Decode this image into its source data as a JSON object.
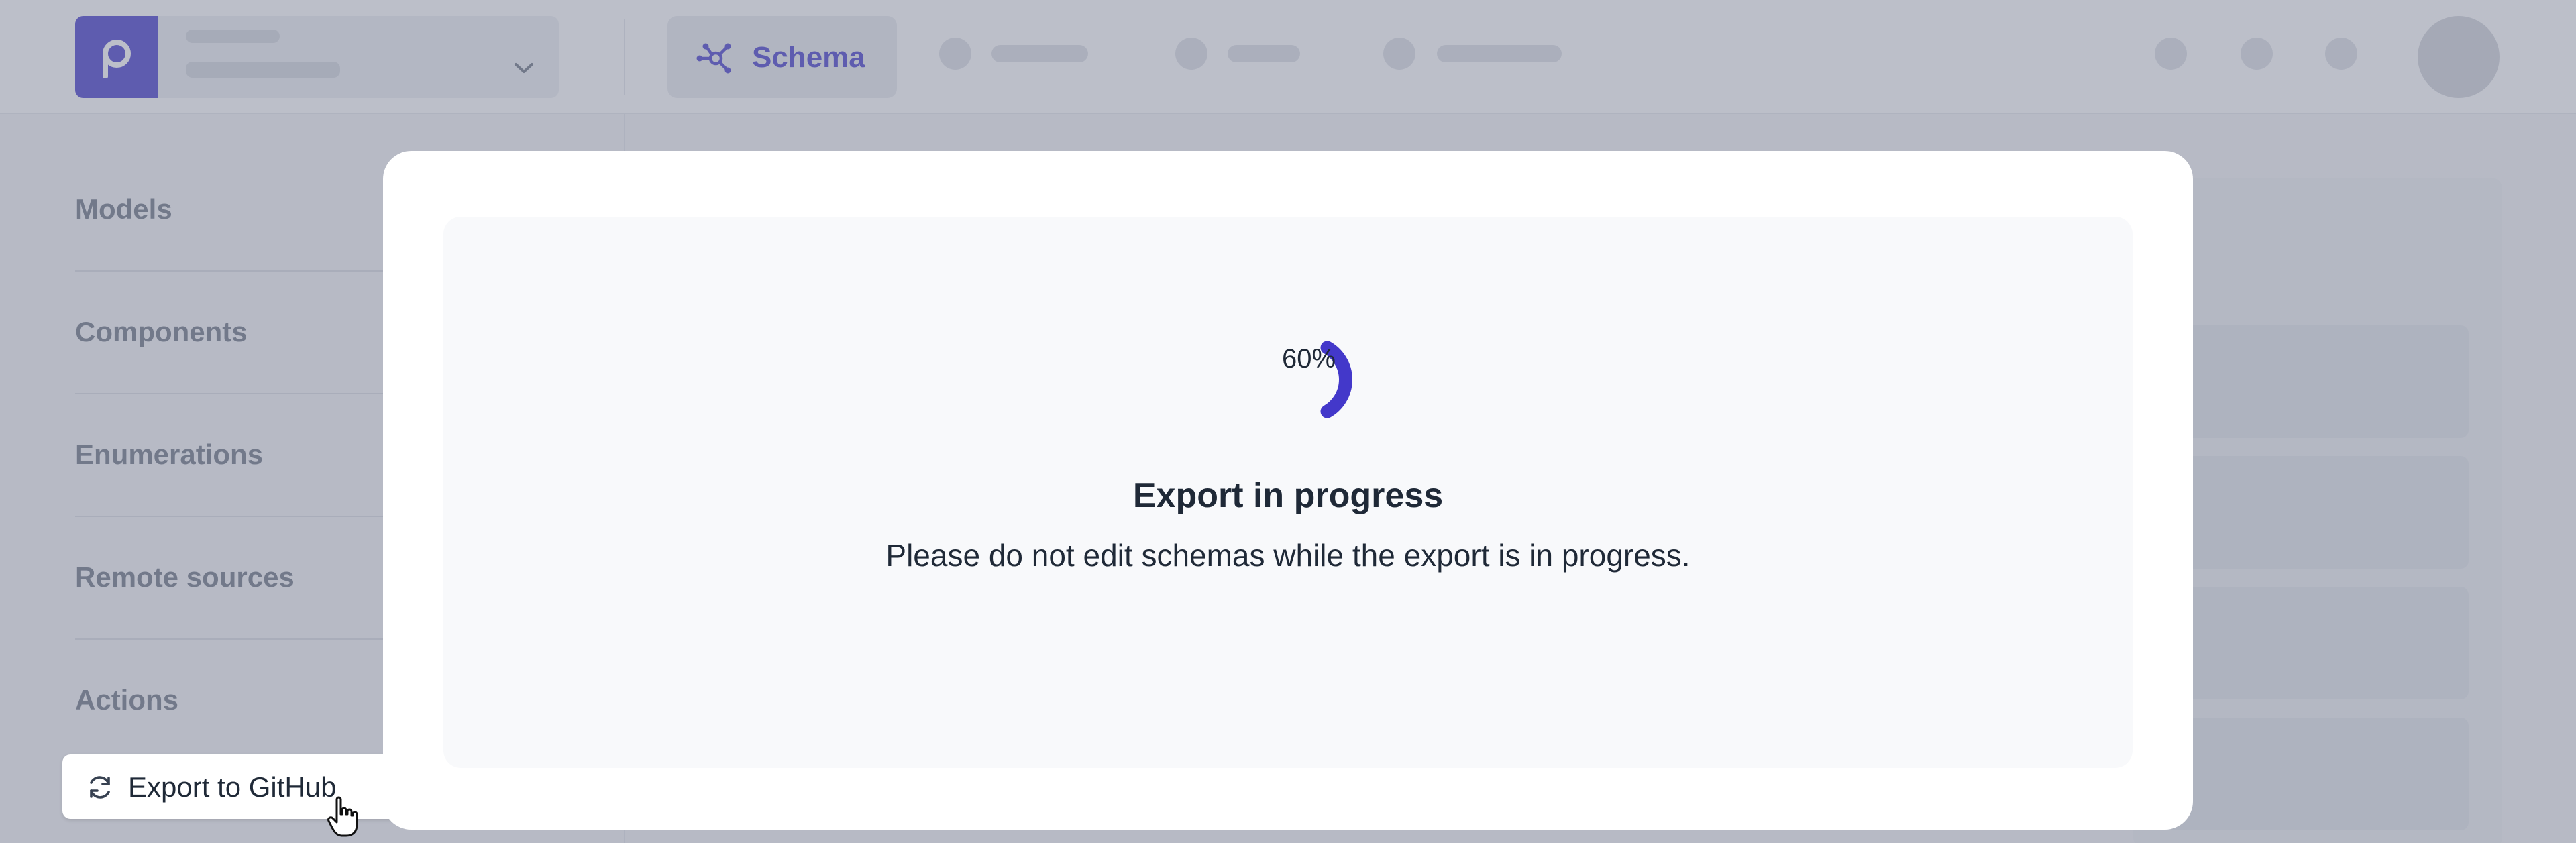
{
  "header": {
    "active_tab_label": "Schema",
    "icons": [
      "project-logo-icon",
      "chevron-down-icon",
      "schema-graph-icon"
    ]
  },
  "sidebar": {
    "sections": [
      "Models",
      "Components",
      "Enumerations",
      "Remote sources",
      "Actions"
    ],
    "export_button_label": "Export to GitHub",
    "export_icon": "refresh-icon"
  },
  "modal": {
    "progress_percent": 60,
    "progress_label": "60%",
    "title": "Export in progress",
    "description": "Please do not edit schemas while the export is in progress."
  },
  "colors": {
    "accent": "#4338ca",
    "overlay": "rgba(122,128,148,0.5)",
    "modal_bg": "#ffffff",
    "modal_inner_bg": "#f8f9fb"
  }
}
